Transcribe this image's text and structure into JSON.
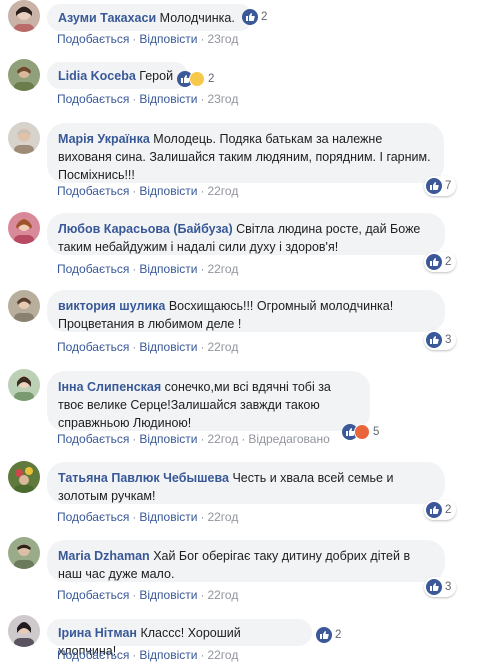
{
  "actions": {
    "like": "Подобається",
    "reply": "Відповісти",
    "edited": "Відредаговано"
  },
  "comments": [
    {
      "author": "Азуми Такахаси",
      "text": "Молодчинка.",
      "time": "23год",
      "reactions": "2",
      "reaction_icons": [
        "like"
      ],
      "avatar_color": "#b86b68"
    },
    {
      "author": "Lidia Koceba",
      "text": "Герой",
      "time": "23год",
      "reactions": "2",
      "reaction_icons": [
        "like",
        "sad"
      ],
      "avatar_color": "#6b7d4a"
    },
    {
      "author": "Марія Українка",
      "text": "Молодець. Подяка батькам за належне вихованя сина. Залишайся таким людяним, порядним. І гарним. Посміхнись!!!",
      "time": "22год",
      "reactions": "7",
      "reaction_icons": [
        "like"
      ],
      "avatar_color": "#9e8c78"
    },
    {
      "author": "Любов Карасьова (Байбуза)",
      "text": "Світла людина росте, дай Боже таким небайдужим і надалі сили духу і здоров'я!",
      "time": "22год",
      "reactions": "2",
      "reaction_icons": [
        "like"
      ],
      "avatar_color": "#b84a64"
    },
    {
      "author": "виктория шулика",
      "text": "Восхищаюсь!!! Огромный молодчинка! Процветания в любимом деле !",
      "time": "22год",
      "reactions": "3",
      "reaction_icons": [
        "like"
      ],
      "avatar_color": "#8a8170"
    },
    {
      "author": "Інна Слипенская",
      "text": "сонечко,ми всі вдячні тобі за твоє велике Серце!Залишайся завжди такою справжньою Людиною!",
      "time": "22год",
      "reactions": "5",
      "reaction_icons": [
        "like",
        "angry"
      ],
      "avatar_color": "#7a9a70"
    },
    {
      "author": "Татьяна Павлюк Чебышева",
      "text": "Честь и хвала всей семье и золотым ручкам!",
      "time": "22год",
      "reactions": "2",
      "reaction_icons": [
        "like"
      ],
      "avatar_color": "#4a6a2e"
    },
    {
      "author": "Maria Dzhaman",
      "text": "Хай Бог оберігає таку дитину добрих дітей в наш час дуже мало.",
      "time": "22год",
      "reactions": "3",
      "reaction_icons": [
        "like"
      ],
      "avatar_color": "#6a7a5a"
    },
    {
      "author": "Ірина Нітман",
      "text": "Классс! Хороший хлопчина!",
      "time": "22год",
      "reactions": "2",
      "reaction_icons": [
        "like"
      ],
      "avatar_color": "#5a5460"
    }
  ]
}
